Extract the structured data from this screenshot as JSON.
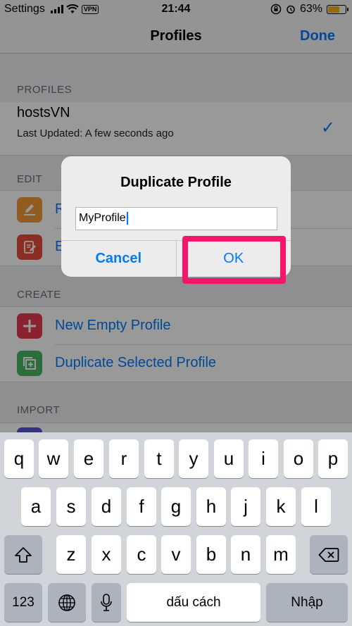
{
  "status": {
    "carrier": "Settings",
    "vpn": "VPN",
    "time": "21:44",
    "battery": "63%"
  },
  "nav": {
    "title": "Profiles",
    "done": "Done"
  },
  "sections": {
    "profiles": "PROFILES",
    "edit": "EDIT",
    "create": "CREATE",
    "import": "IMPORT"
  },
  "profile": {
    "name": "hostsVN",
    "subtitle": "Last Updated: A few seconds ago"
  },
  "edit_items": [
    "R",
    "E"
  ],
  "create_items": [
    "New Empty Profile",
    "Duplicate Selected Profile"
  ],
  "alert": {
    "title": "Duplicate Profile",
    "value": "MyProfile",
    "cancel": "Cancel",
    "ok": "OK"
  },
  "keyboard": {
    "row1": [
      "q",
      "w",
      "e",
      "r",
      "t",
      "y",
      "u",
      "i",
      "o",
      "p"
    ],
    "row2": [
      "a",
      "s",
      "d",
      "f",
      "g",
      "h",
      "j",
      "k",
      "l"
    ],
    "row3": [
      "z",
      "x",
      "c",
      "v",
      "b",
      "n",
      "m"
    ],
    "numbers": "123",
    "space": "dấu cách",
    "return": "Nhập"
  },
  "colors": {
    "accent": "#007aff",
    "highlight": "#f5156b",
    "edit1": "#f09a37",
    "edit2": "#e94b3c",
    "create1": "#e83a4f",
    "create2": "#4cb665"
  }
}
